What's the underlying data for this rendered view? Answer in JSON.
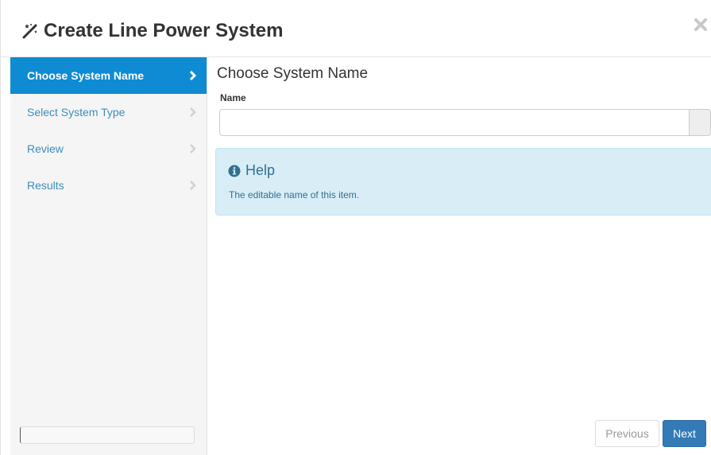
{
  "dialog": {
    "title": "Create Line Power System",
    "title_icon": "magic-wand-icon",
    "close_icon": "close-icon"
  },
  "sidebar": {
    "items": [
      {
        "label": "Choose System Name",
        "active": true
      },
      {
        "label": "Select System Type",
        "active": false
      },
      {
        "label": "Review",
        "active": false
      },
      {
        "label": "Results",
        "active": false
      }
    ],
    "chevron_icon": "chevron-right-icon"
  },
  "main": {
    "section_title": "Choose System Name",
    "name_label": "Name",
    "name_value": "",
    "name_placeholder": "",
    "help": {
      "title": "Help",
      "icon": "info-circle-icon",
      "text": "The editable name of this item."
    }
  },
  "footer": {
    "previous_label": "Previous",
    "next_label": "Next"
  },
  "colors": {
    "active_nav_bg": "#0f8bd4",
    "link": "#3c8dbc",
    "help_bg": "#d9edf7",
    "help_text": "#31708f",
    "primary_button": "#337ab7",
    "sidebar_bg": "#f5f5f5"
  }
}
